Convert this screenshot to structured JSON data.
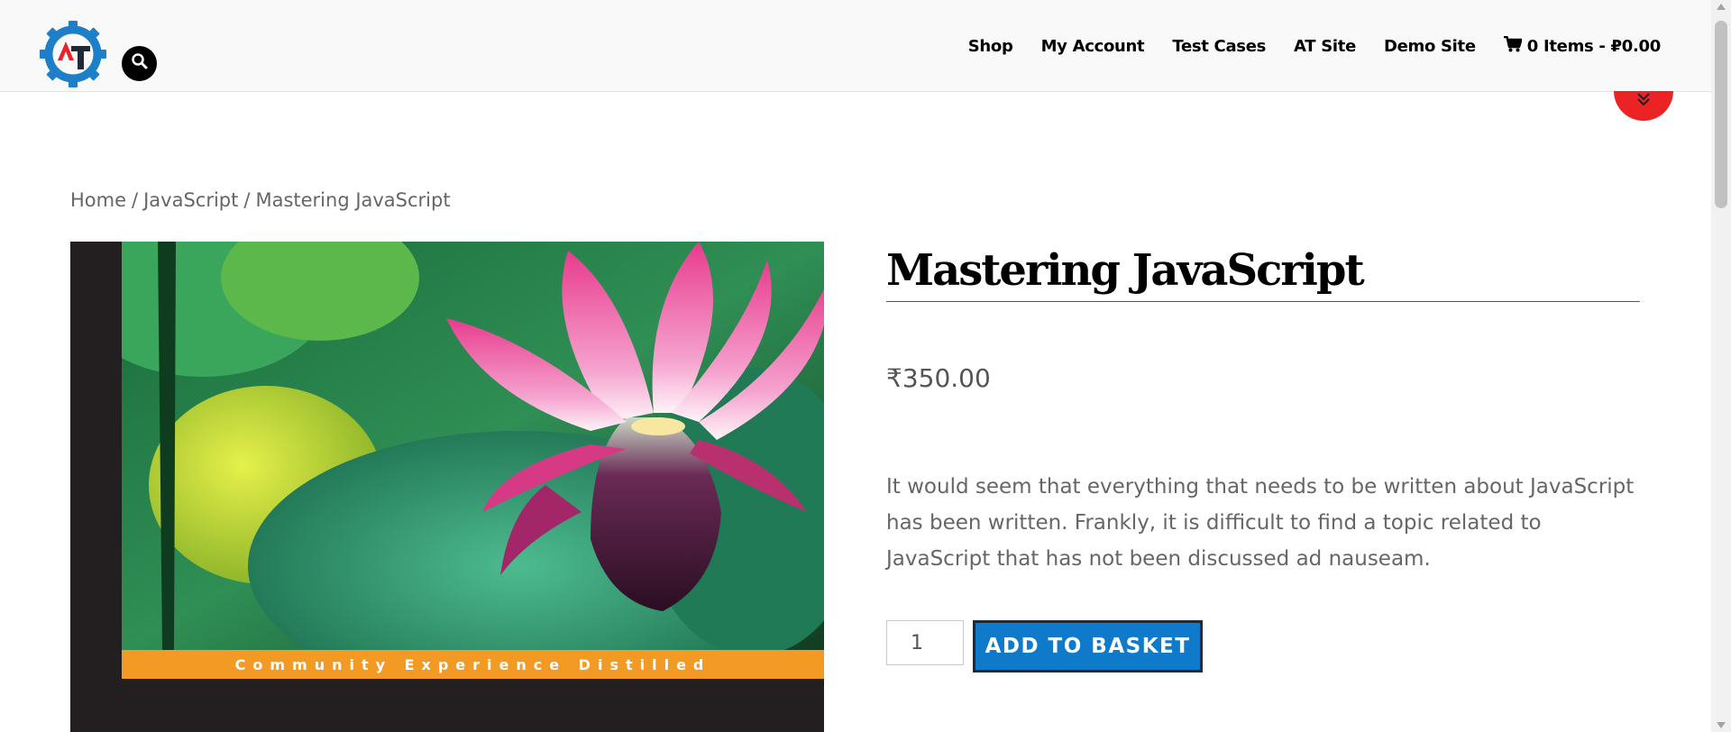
{
  "header": {
    "nav": [
      {
        "label": "Shop"
      },
      {
        "label": "My Account"
      },
      {
        "label": "Test Cases"
      },
      {
        "label": "AT Site"
      },
      {
        "label": "Demo Site"
      }
    ],
    "cart": {
      "label": "0 Items - ₽0.00",
      "icon": "shopping-cart-icon"
    },
    "logo_icon": "gear-logo-icon",
    "search_icon": "search-icon",
    "scroll_icon": "double-chevron-down-icon"
  },
  "breadcrumb": {
    "items": [
      "Home",
      "JavaScript",
      "Mastering JavaScript"
    ],
    "separator": "/"
  },
  "product": {
    "title": "Mastering JavaScript",
    "price": "₹350.00",
    "description": "It would seem that everything that needs to be written about JavaScript has been written. Frankly, it is difficult to find a topic related to JavaScript that has not been discussed ad nauseam.",
    "quantity": "1",
    "add_button": "ADD TO BASKET",
    "cover_strip_text": "Community Experience Distilled"
  },
  "colors": {
    "accent_blue": "#0f7ac9",
    "scroll_red": "#ec2224",
    "cover_orange": "#f39a24"
  }
}
